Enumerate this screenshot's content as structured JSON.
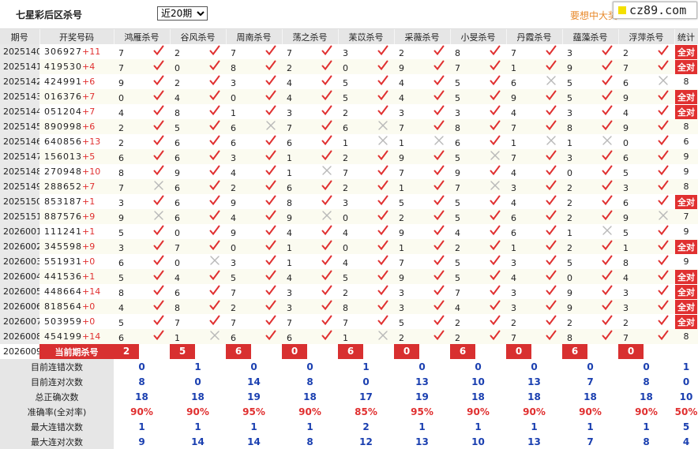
{
  "header": {
    "title": "七星彩后区杀号",
    "period_select": "近20期",
    "promo": "要想中大奖",
    "logo": "cz89.com"
  },
  "colors": {
    "accent_red": "#d83030",
    "stat_blue": "#1a3fb0",
    "promo_orange": "#e8892b"
  },
  "columns": [
    "期号",
    "开奖号码",
    "鸿雁杀号",
    "谷风杀号",
    "周南杀号",
    "荡之杀号",
    "苿苡杀号",
    "采薇杀号",
    "小旻杀号",
    "丹霞杀号",
    "蕴藻杀号",
    "浮萍杀号",
    "统计"
  ],
  "rows": [
    {
      "period": "2025140",
      "draw": "306927",
      "plus": "+11",
      "picks": [
        [
          "7",
          "ok"
        ],
        [
          "2",
          "ok"
        ],
        [
          "7",
          "ok"
        ],
        [
          "7",
          "ok"
        ],
        [
          "3",
          "ok"
        ],
        [
          "2",
          "ok"
        ],
        [
          "8",
          "ok"
        ],
        [
          "7",
          "ok"
        ],
        [
          "3",
          "ok"
        ],
        [
          "2",
          "ok"
        ]
      ],
      "stat": "全对"
    },
    {
      "period": "2025141",
      "draw": "419530",
      "plus": "+4",
      "picks": [
        [
          "7",
          "ok"
        ],
        [
          "0",
          "ok"
        ],
        [
          "8",
          "ok"
        ],
        [
          "2",
          "ok"
        ],
        [
          "0",
          "ok"
        ],
        [
          "9",
          "ok"
        ],
        [
          "7",
          "ok"
        ],
        [
          "1",
          "ok"
        ],
        [
          "9",
          "ok"
        ],
        [
          "7",
          "ok"
        ]
      ],
      "stat": "全对"
    },
    {
      "period": "2025142",
      "draw": "424991",
      "plus": "+6",
      "picks": [
        [
          "9",
          "ok"
        ],
        [
          "2",
          "ok"
        ],
        [
          "3",
          "ok"
        ],
        [
          "4",
          "ok"
        ],
        [
          "5",
          "ok"
        ],
        [
          "4",
          "ok"
        ],
        [
          "5",
          "ok"
        ],
        [
          "6",
          "no"
        ],
        [
          "5",
          "ok"
        ],
        [
          "6",
          "no"
        ]
      ],
      "stat": "8"
    },
    {
      "period": "2025143",
      "draw": "016376",
      "plus": "+7",
      "picks": [
        [
          "0",
          "ok"
        ],
        [
          "4",
          "ok"
        ],
        [
          "0",
          "ok"
        ],
        [
          "4",
          "ok"
        ],
        [
          "5",
          "ok"
        ],
        [
          "4",
          "ok"
        ],
        [
          "5",
          "ok"
        ],
        [
          "9",
          "ok"
        ],
        [
          "5",
          "ok"
        ],
        [
          "9",
          "ok"
        ]
      ],
      "stat": "全对"
    },
    {
      "period": "2025144",
      "draw": "051204",
      "plus": "+7",
      "picks": [
        [
          "4",
          "ok"
        ],
        [
          "8",
          "ok"
        ],
        [
          "1",
          "ok"
        ],
        [
          "3",
          "ok"
        ],
        [
          "2",
          "ok"
        ],
        [
          "3",
          "ok"
        ],
        [
          "3",
          "ok"
        ],
        [
          "4",
          "ok"
        ],
        [
          "3",
          "ok"
        ],
        [
          "4",
          "ok"
        ]
      ],
      "stat": "全对"
    },
    {
      "period": "2025145",
      "draw": "890998",
      "plus": "+6",
      "picks": [
        [
          "2",
          "ok"
        ],
        [
          "5",
          "ok"
        ],
        [
          "6",
          "no"
        ],
        [
          "7",
          "ok"
        ],
        [
          "6",
          "no"
        ],
        [
          "7",
          "ok"
        ],
        [
          "8",
          "ok"
        ],
        [
          "7",
          "ok"
        ],
        [
          "8",
          "ok"
        ],
        [
          "9",
          "ok"
        ]
      ],
      "stat": "8"
    },
    {
      "period": "2025146",
      "draw": "640856",
      "plus": "+13",
      "picks": [
        [
          "2",
          "ok"
        ],
        [
          "6",
          "ok"
        ],
        [
          "6",
          "ok"
        ],
        [
          "6",
          "ok"
        ],
        [
          "1",
          "no"
        ],
        [
          "1",
          "no"
        ],
        [
          "6",
          "ok"
        ],
        [
          "1",
          "no"
        ],
        [
          "1",
          "no"
        ],
        [
          "0",
          "ok"
        ]
      ],
      "stat": "6"
    },
    {
      "period": "2025147",
      "draw": "156013",
      "plus": "+5",
      "picks": [
        [
          "6",
          "ok"
        ],
        [
          "6",
          "ok"
        ],
        [
          "3",
          "ok"
        ],
        [
          "1",
          "ok"
        ],
        [
          "2",
          "ok"
        ],
        [
          "9",
          "ok"
        ],
        [
          "5",
          "no"
        ],
        [
          "7",
          "ok"
        ],
        [
          "3",
          "ok"
        ],
        [
          "6",
          "ok"
        ]
      ],
      "stat": "9"
    },
    {
      "period": "2025148",
      "draw": "270948",
      "plus": "+10",
      "picks": [
        [
          "8",
          "ok"
        ],
        [
          "9",
          "ok"
        ],
        [
          "4",
          "ok"
        ],
        [
          "1",
          "no"
        ],
        [
          "7",
          "ok"
        ],
        [
          "7",
          "ok"
        ],
        [
          "9",
          "ok"
        ],
        [
          "4",
          "ok"
        ],
        [
          "0",
          "ok"
        ],
        [
          "5",
          "ok"
        ]
      ],
      "stat": "9"
    },
    {
      "period": "2025149",
      "draw": "288652",
      "plus": "+7",
      "picks": [
        [
          "7",
          "no"
        ],
        [
          "6",
          "ok"
        ],
        [
          "2",
          "ok"
        ],
        [
          "6",
          "ok"
        ],
        [
          "2",
          "ok"
        ],
        [
          "1",
          "ok"
        ],
        [
          "7",
          "no"
        ],
        [
          "3",
          "ok"
        ],
        [
          "2",
          "ok"
        ],
        [
          "3",
          "ok"
        ]
      ],
      "stat": "8"
    },
    {
      "period": "2025150",
      "draw": "853187",
      "plus": "+1",
      "picks": [
        [
          "3",
          "ok"
        ],
        [
          "6",
          "ok"
        ],
        [
          "9",
          "ok"
        ],
        [
          "8",
          "ok"
        ],
        [
          "3",
          "ok"
        ],
        [
          "5",
          "ok"
        ],
        [
          "5",
          "ok"
        ],
        [
          "4",
          "ok"
        ],
        [
          "2",
          "ok"
        ],
        [
          "6",
          "ok"
        ]
      ],
      "stat": "全对"
    },
    {
      "period": "2025151",
      "draw": "887576",
      "plus": "+9",
      "picks": [
        [
          "9",
          "no"
        ],
        [
          "6",
          "ok"
        ],
        [
          "4",
          "ok"
        ],
        [
          "9",
          "no"
        ],
        [
          "0",
          "ok"
        ],
        [
          "2",
          "ok"
        ],
        [
          "5",
          "ok"
        ],
        [
          "6",
          "ok"
        ],
        [
          "2",
          "ok"
        ],
        [
          "9",
          "no"
        ]
      ],
      "stat": "7"
    },
    {
      "period": "2026001",
      "draw": "111241",
      "plus": "+1",
      "picks": [
        [
          "5",
          "ok"
        ],
        [
          "0",
          "ok"
        ],
        [
          "9",
          "ok"
        ],
        [
          "4",
          "ok"
        ],
        [
          "4",
          "ok"
        ],
        [
          "9",
          "ok"
        ],
        [
          "4",
          "ok"
        ],
        [
          "6",
          "ok"
        ],
        [
          "1",
          "no"
        ],
        [
          "5",
          "ok"
        ]
      ],
      "stat": "9"
    },
    {
      "period": "2026002",
      "draw": "345598",
      "plus": "+9",
      "picks": [
        [
          "3",
          "ok"
        ],
        [
          "7",
          "ok"
        ],
        [
          "0",
          "ok"
        ],
        [
          "1",
          "ok"
        ],
        [
          "0",
          "ok"
        ],
        [
          "1",
          "ok"
        ],
        [
          "2",
          "ok"
        ],
        [
          "1",
          "ok"
        ],
        [
          "2",
          "ok"
        ],
        [
          "1",
          "ok"
        ]
      ],
      "stat": "全对"
    },
    {
      "period": "2026003",
      "draw": "551931",
      "plus": "+0",
      "picks": [
        [
          "6",
          "ok"
        ],
        [
          "0",
          "no"
        ],
        [
          "3",
          "ok"
        ],
        [
          "1",
          "ok"
        ],
        [
          "4",
          "ok"
        ],
        [
          "7",
          "ok"
        ],
        [
          "5",
          "ok"
        ],
        [
          "3",
          "ok"
        ],
        [
          "5",
          "ok"
        ],
        [
          "8",
          "ok"
        ]
      ],
      "stat": "9"
    },
    {
      "period": "2026004",
      "draw": "441536",
      "plus": "+1",
      "picks": [
        [
          "5",
          "ok"
        ],
        [
          "4",
          "ok"
        ],
        [
          "5",
          "ok"
        ],
        [
          "4",
          "ok"
        ],
        [
          "5",
          "ok"
        ],
        [
          "9",
          "ok"
        ],
        [
          "5",
          "ok"
        ],
        [
          "4",
          "ok"
        ],
        [
          "0",
          "ok"
        ],
        [
          "4",
          "ok"
        ]
      ],
      "stat": "全对"
    },
    {
      "period": "2026005",
      "draw": "448664",
      "plus": "+14",
      "picks": [
        [
          "8",
          "ok"
        ],
        [
          "6",
          "ok"
        ],
        [
          "7",
          "ok"
        ],
        [
          "3",
          "ok"
        ],
        [
          "2",
          "ok"
        ],
        [
          "3",
          "ok"
        ],
        [
          "7",
          "ok"
        ],
        [
          "3",
          "ok"
        ],
        [
          "9",
          "ok"
        ],
        [
          "3",
          "ok"
        ]
      ],
      "stat": "全对"
    },
    {
      "period": "2026006",
      "draw": "818564",
      "plus": "+0",
      "picks": [
        [
          "4",
          "ok"
        ],
        [
          "8",
          "ok"
        ],
        [
          "2",
          "ok"
        ],
        [
          "3",
          "ok"
        ],
        [
          "8",
          "ok"
        ],
        [
          "3",
          "ok"
        ],
        [
          "4",
          "ok"
        ],
        [
          "3",
          "ok"
        ],
        [
          "9",
          "ok"
        ],
        [
          "3",
          "ok"
        ]
      ],
      "stat": "全对"
    },
    {
      "period": "2026007",
      "draw": "503959",
      "plus": "+0",
      "picks": [
        [
          "5",
          "ok"
        ],
        [
          "7",
          "ok"
        ],
        [
          "7",
          "ok"
        ],
        [
          "7",
          "ok"
        ],
        [
          "7",
          "ok"
        ],
        [
          "5",
          "ok"
        ],
        [
          "2",
          "ok"
        ],
        [
          "2",
          "ok"
        ],
        [
          "2",
          "ok"
        ],
        [
          "2",
          "ok"
        ]
      ],
      "stat": "全对"
    },
    {
      "period": "2026008",
      "draw": "454199",
      "plus": "+14",
      "picks": [
        [
          "6",
          "ok"
        ],
        [
          "1",
          "no"
        ],
        [
          "6",
          "ok"
        ],
        [
          "6",
          "ok"
        ],
        [
          "1",
          "no"
        ],
        [
          "2",
          "ok"
        ],
        [
          "2",
          "ok"
        ],
        [
          "7",
          "ok"
        ],
        [
          "8",
          "ok"
        ],
        [
          "7",
          "ok"
        ]
      ],
      "stat": "8"
    }
  ],
  "current": {
    "period": "2026009",
    "label": "当前期杀号",
    "picks": [
      "2",
      "5",
      "6",
      "0",
      "6",
      "0",
      "6",
      "0",
      "6",
      "0"
    ]
  },
  "summary": [
    {
      "label": "目前连错次数",
      "values": [
        "0",
        "1",
        "0",
        "0",
        "1",
        "0",
        "0",
        "0",
        "0",
        "0",
        "1"
      ],
      "red": false
    },
    {
      "label": "目前连对次数",
      "values": [
        "8",
        "0",
        "14",
        "8",
        "0",
        "13",
        "10",
        "13",
        "7",
        "8",
        "0"
      ],
      "red": false
    },
    {
      "label": "总正确次数",
      "values": [
        "18",
        "18",
        "19",
        "18",
        "17",
        "19",
        "18",
        "18",
        "18",
        "18",
        "10"
      ],
      "red": false
    },
    {
      "label": "准确率(全对率)",
      "values": [
        "90%",
        "90%",
        "95%",
        "90%",
        "85%",
        "95%",
        "90%",
        "90%",
        "90%",
        "90%",
        "50%"
      ],
      "red": true
    },
    {
      "label": "最大连错次数",
      "values": [
        "1",
        "1",
        "1",
        "1",
        "2",
        "1",
        "1",
        "1",
        "1",
        "1",
        "5"
      ],
      "red": false
    },
    {
      "label": "最大连对次数",
      "values": [
        "9",
        "14",
        "14",
        "8",
        "12",
        "13",
        "10",
        "13",
        "7",
        "8",
        "4"
      ],
      "red": false
    }
  ]
}
